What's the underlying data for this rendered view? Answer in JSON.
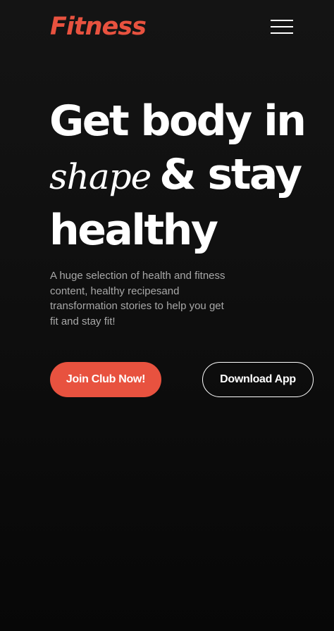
{
  "header": {
    "logo_text": "Fitness",
    "menu_icon": "hamburger-menu-icon"
  },
  "hero": {
    "headline_line1": "Get body in",
    "headline_script_word": "shape",
    "headline_line2_rest": "& stay",
    "headline_line3": "healthy",
    "description": "A huge selection of health and fitness content, healthy recipesand transformation stories to help you get fit and stay fit!"
  },
  "actions": {
    "join_label": "Join Club Now!",
    "download_label": "Download App"
  },
  "colors": {
    "accent": "#e8523f",
    "background": "#0f0f0f",
    "text_primary": "#ffffff",
    "text_secondary": "#a8a8a8"
  }
}
